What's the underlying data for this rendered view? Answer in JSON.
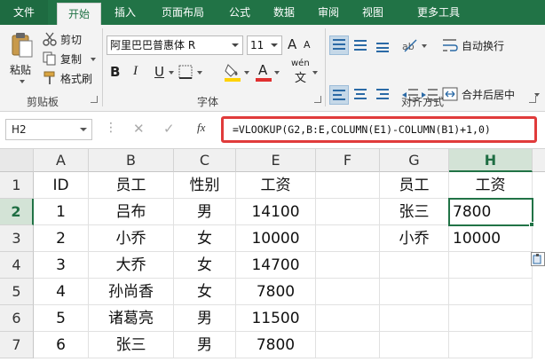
{
  "tabs": [
    {
      "label": "文件"
    },
    {
      "label": "开始"
    },
    {
      "label": "插入"
    },
    {
      "label": "页面布局"
    },
    {
      "label": "公式"
    },
    {
      "label": "数据"
    },
    {
      "label": "审阅"
    },
    {
      "label": "视图"
    },
    {
      "label": "更多工具"
    }
  ],
  "ribbon": {
    "clipboard": {
      "paste_label": "粘贴",
      "cut_label": "剪切",
      "copy_label": "复制",
      "format_painter_label": "格式刷",
      "group_label": "剪贴板"
    },
    "font": {
      "font_name": "阿里巴巴普惠体 R",
      "font_size": "11",
      "grow_label": "A",
      "shrink_label": "A",
      "bold_label": "B",
      "italic_label": "I",
      "underline_label": "U",
      "font_color_label": "A",
      "phonetic_label": "wén",
      "group_label": "字体"
    },
    "alignment": {
      "wrap_label": "自动换行",
      "merge_label": "合并后居中",
      "group_label": "对齐方式"
    }
  },
  "formula_bar": {
    "name_box": "H2",
    "cancel_icon": "✕",
    "enter_icon": "✓",
    "fx_label": "fx",
    "formula": "=VLOOKUP(G2,B:E,COLUMN(E1)-COLUMN(B1)+1,0)"
  },
  "sheet": {
    "columns": [
      "A",
      "B",
      "C",
      "E",
      "F",
      "G",
      "H"
    ],
    "selected_column": "H",
    "rows": [
      "1",
      "2",
      "3",
      "4",
      "5",
      "6",
      "7"
    ],
    "selected_row": "2",
    "cells": [
      [
        "ID",
        "员工",
        "性别",
        "工资",
        "",
        "员工",
        "工资"
      ],
      [
        "1",
        "吕布",
        "男",
        "14100",
        "",
        "张三",
        "7800"
      ],
      [
        "2",
        "小乔",
        "女",
        "10000",
        "",
        "小乔",
        "10000"
      ],
      [
        "3",
        "大乔",
        "女",
        "14700",
        "",
        "",
        ""
      ],
      [
        "4",
        "孙尚香",
        "女",
        "7800",
        "",
        "",
        ""
      ],
      [
        "5",
        "诸葛亮",
        "男",
        "11500",
        "",
        "",
        ""
      ],
      [
        "6",
        "张三",
        "男",
        "7800",
        "",
        "",
        ""
      ]
    ]
  },
  "colors": {
    "accent": "#217346",
    "formula_highlight": "#e03b3b",
    "font_color_bar": "#e03030",
    "fill_color_bar": "#ffd200"
  }
}
